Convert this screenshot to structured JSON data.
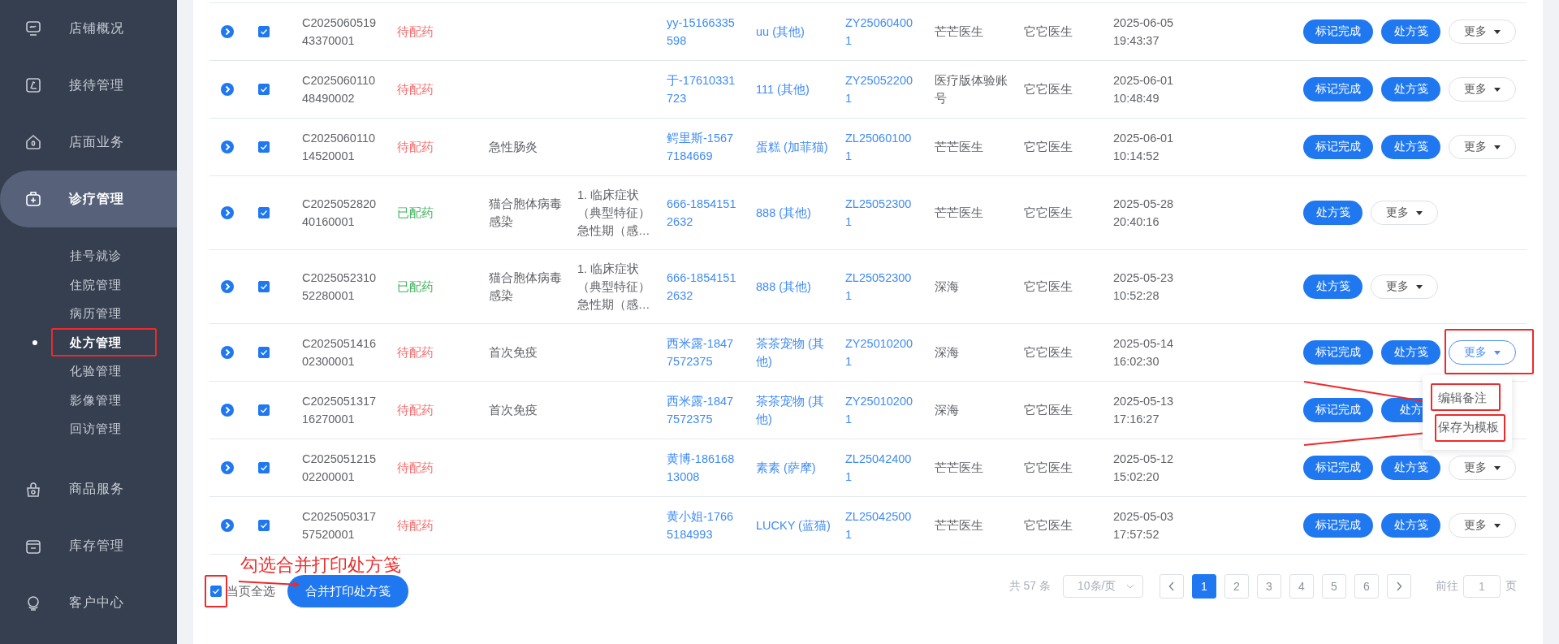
{
  "sidebar": {
    "items": [
      {
        "label": "店铺概况",
        "selected": false
      },
      {
        "label": "接待管理",
        "selected": false
      },
      {
        "label": "店面业务",
        "selected": false
      },
      {
        "label": "诊疗管理",
        "selected": true,
        "children": [
          {
            "label": "挂号就诊",
            "selected": false,
            "highlighted": false
          },
          {
            "label": "住院管理",
            "selected": false,
            "highlighted": false
          },
          {
            "label": "病历管理",
            "selected": false,
            "highlighted": false
          },
          {
            "label": "处方管理",
            "selected": true,
            "highlighted": true
          },
          {
            "label": "化验管理",
            "selected": false,
            "highlighted": false
          },
          {
            "label": "影像管理",
            "selected": false,
            "highlighted": false
          },
          {
            "label": "回访管理",
            "selected": false,
            "highlighted": false
          }
        ]
      },
      {
        "label": "商品服务",
        "selected": false
      },
      {
        "label": "库存管理",
        "selected": false
      },
      {
        "label": "客户中心",
        "selected": false
      }
    ]
  },
  "table": {
    "rows": [
      {
        "checked": true,
        "order_no": "C202506051943370001",
        "status": {
          "label": "待配药",
          "kind": "pending"
        },
        "customer": "yy-15166335598",
        "pet": "uu (其他)",
        "record_no": "ZY250604001",
        "doctor": "芒芒医生",
        "doctor_2": "它它医生",
        "time": "2025-06-05 19:43:37",
        "actions": [
          {
            "label": "标记完成",
            "kind": "primary"
          },
          {
            "label": "处方笺",
            "kind": "primary"
          },
          {
            "label": "更多",
            "kind": "dropdown",
            "active": false,
            "highlighted": false
          }
        ]
      },
      {
        "checked": true,
        "order_no": "C202506011048490002",
        "status": {
          "label": "待配药",
          "kind": "pending"
        },
        "customer": "于-17610331723",
        "pet": "111 (其他)",
        "record_no": "ZY250522001",
        "doctor": "医疗版体验账号",
        "doctor_2": "它它医生",
        "time": "2025-06-01 10:48:49",
        "actions": [
          {
            "label": "标记完成",
            "kind": "primary"
          },
          {
            "label": "处方笺",
            "kind": "primary"
          },
          {
            "label": "更多",
            "kind": "dropdown",
            "active": false,
            "highlighted": false
          }
        ]
      },
      {
        "checked": true,
        "order_no": "C202506011014520001",
        "status": {
          "label": "待配药",
          "kind": "pending"
        },
        "diagnosis": "急性肠炎",
        "customer": "鳄里斯-15677184669",
        "pet": "蛋糕 (加菲猫)",
        "record_no": "ZL250601001",
        "doctor": "芒芒医生",
        "doctor_2": "它它医生",
        "time": "2025-06-01 10:14:52",
        "actions": [
          {
            "label": "标记完成",
            "kind": "primary"
          },
          {
            "label": "处方笺",
            "kind": "primary"
          },
          {
            "label": "更多",
            "kind": "dropdown",
            "active": false,
            "highlighted": false
          }
        ]
      },
      {
        "checked": true,
        "order_no": "C202505282040160001",
        "status": {
          "label": "已配药",
          "kind": "dispensed"
        },
        "diagnosis": "猫合胞体病毒感染",
        "symptoms": "1. 临床症状（典型特征）急性期（感…",
        "customer": "666-18541512632",
        "pet": "888 (其他)",
        "record_no": "ZL250523001",
        "doctor": "芒芒医生",
        "doctor_2": "它它医生",
        "time": "2025-05-28 20:40:16",
        "actions": [
          {
            "label": "处方笺",
            "kind": "primary"
          },
          {
            "label": "更多",
            "kind": "dropdown",
            "active": false,
            "highlighted": false
          }
        ]
      },
      {
        "checked": true,
        "order_no": "C202505231052280001",
        "status": {
          "label": "已配药",
          "kind": "dispensed"
        },
        "diagnosis": "猫合胞体病毒感染",
        "symptoms": "1. 临床症状（典型特征）急性期（感…",
        "customer": "666-18541512632",
        "pet": "888 (其他)",
        "record_no": "ZL250523001",
        "doctor": "深海",
        "doctor_2": "它它医生",
        "time": "2025-05-23 10:52:28",
        "actions": [
          {
            "label": "处方笺",
            "kind": "primary"
          },
          {
            "label": "更多",
            "kind": "dropdown",
            "active": false,
            "highlighted": false
          }
        ]
      },
      {
        "checked": true,
        "order_no": "C202505141602300001",
        "status": {
          "label": "待配药",
          "kind": "pending"
        },
        "diagnosis": "首次免疫",
        "customer": "西米露-18477572375",
        "pet": "茶茶宠物 (其他)",
        "record_no": "ZY250102001",
        "doctor": "深海",
        "doctor_2": "它它医生",
        "time": "2025-05-14 16:02:30",
        "actions": [
          {
            "label": "标记完成",
            "kind": "primary"
          },
          {
            "label": "处方笺",
            "kind": "primary"
          },
          {
            "label": "更多",
            "kind": "dropdown",
            "active": true,
            "highlighted": true,
            "menu": [
              {
                "label": "编辑备注",
                "highlighted": true
              },
              {
                "label": "保存为模板",
                "highlighted": true
              }
            ]
          }
        ]
      },
      {
        "checked": true,
        "order_no": "C202505131716270001",
        "status": {
          "label": "待配药",
          "kind": "pending"
        },
        "diagnosis": "首次免疫",
        "customer": "西米露-18477572375",
        "pet": "茶茶宠物 (其他)",
        "record_no": "ZY250102001",
        "doctor": "深海",
        "doctor_2": "它它医生",
        "time": "2025-05-13 17:16:27",
        "actions": [
          {
            "label": "标记完成",
            "kind": "primary"
          },
          {
            "label": "处方",
            "kind": "primary"
          }
        ]
      },
      {
        "checked": true,
        "order_no": "C202505121502200001",
        "status": {
          "label": "待配药",
          "kind": "pending"
        },
        "customer": "黄博-18616813008",
        "pet": "素素 (萨摩)",
        "record_no": "ZL250424001",
        "doctor": "芒芒医生",
        "doctor_2": "它它医生",
        "time": "2025-05-12 15:02:20",
        "actions": [
          {
            "label": "标记完成",
            "kind": "primary"
          },
          {
            "label": "处方笺",
            "kind": "primary"
          },
          {
            "label": "更多",
            "kind": "dropdown",
            "active": false,
            "highlighted": false
          }
        ]
      },
      {
        "checked": true,
        "order_no": "C202505031757520001",
        "status": {
          "label": "待配药",
          "kind": "pending"
        },
        "customer": "黄小姐-17665184993",
        "pet": "LUCKY (蓝猫)",
        "record_no": "ZL250425001",
        "doctor": "芒芒医生",
        "doctor_2": "它它医生",
        "time": "2025-05-03 17:57:52",
        "actions": [
          {
            "label": "标记完成",
            "kind": "primary"
          },
          {
            "label": "处方笺",
            "kind": "primary"
          },
          {
            "label": "更多",
            "kind": "dropdown",
            "active": false,
            "highlighted": false
          }
        ]
      }
    ]
  },
  "footer": {
    "annotation": "勾选合并打印处方笺",
    "select_all": {
      "label": "当页全选",
      "checked": true,
      "highlighted": true
    },
    "merge_print_button": "合并打印处方笺"
  },
  "pagination": {
    "total": "共 57 条",
    "page_size": "10条/页",
    "pages": [
      {
        "label": "1",
        "selected": true
      },
      {
        "label": "2",
        "selected": false
      },
      {
        "label": "3",
        "selected": false
      },
      {
        "label": "4",
        "selected": false
      },
      {
        "label": "5",
        "selected": false
      },
      {
        "label": "6",
        "selected": false
      }
    ],
    "goto_label": "前往",
    "goto_value": "1",
    "goto_suffix": "页"
  }
}
